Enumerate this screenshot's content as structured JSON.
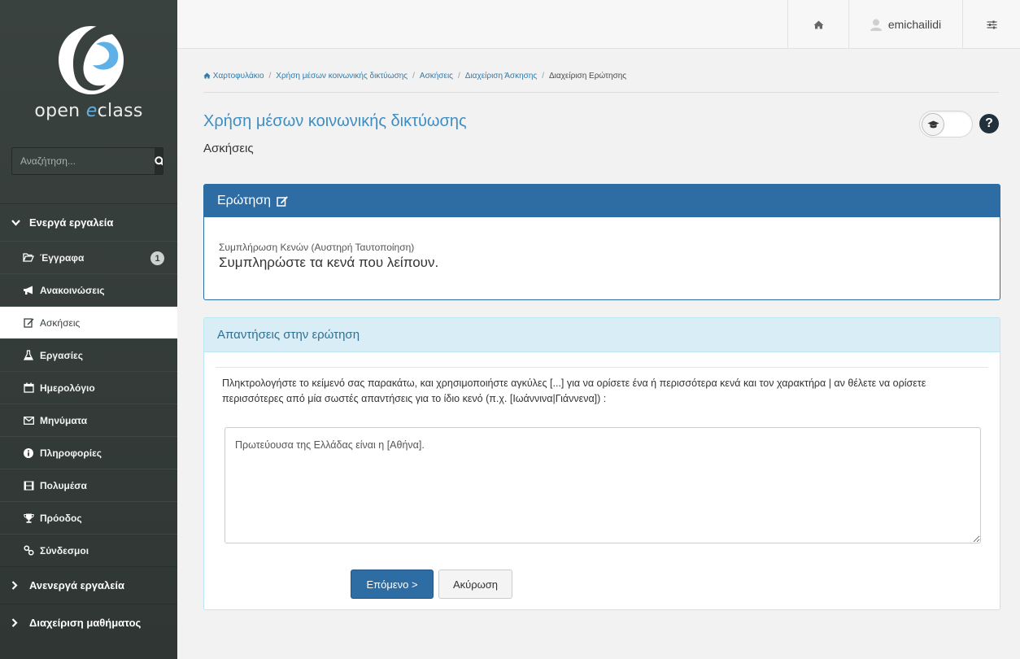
{
  "sidebar": {
    "logo_text_1": "open ",
    "logo_text_e": "e",
    "logo_text_2": "class",
    "search": {
      "placeholder": "Αναζήτηση..."
    },
    "active_tools_label": "Ενεργά εργαλεία",
    "items": [
      {
        "label": "Έγγραφα",
        "icon": "folder-open-icon",
        "badge": "1"
      },
      {
        "label": "Ανακοινώσεις",
        "icon": "bullhorn-icon"
      },
      {
        "label": "Ασκήσεις",
        "icon": "edit-icon",
        "active": true
      },
      {
        "label": "Εργασίες",
        "icon": "flask-icon"
      },
      {
        "label": "Ημερολόγιο",
        "icon": "calendar-icon"
      },
      {
        "label": "Μηνύματα",
        "icon": "envelope-icon"
      },
      {
        "label": "Πληροφορίες",
        "icon": "info-icon"
      },
      {
        "label": "Πολυμέσα",
        "icon": "film-icon"
      },
      {
        "label": "Πρόοδος",
        "icon": "trophy-icon"
      },
      {
        "label": "Σύνδεσμοι",
        "icon": "link-icon"
      }
    ],
    "inactive_tools_label": "Ανενεργά εργαλεία",
    "course_admin_label": "Διαχείριση μαθήματος"
  },
  "topbar": {
    "username": "emichailidi"
  },
  "breadcrumb": [
    "Χαρτοφυλάκιο",
    "Χρήση μέσων κοινωνικής δικτύωσης",
    "Ασκήσεις",
    "Διαχείριση Άσκησης",
    "Διαχείριση Ερώτησης"
  ],
  "course": {
    "title": "Χρήση μέσων κοινωνικής δικτύωσης",
    "subtitle": "Ασκήσεις"
  },
  "question_panel": {
    "title": "Ερώτηση",
    "type": "Συμπλήρωση Κενών (Αυστηρή Ταυτοποίηση)",
    "text": "Συμπληρώστε τα κενά που λείπουν."
  },
  "answers_panel": {
    "title": "Απαντήσεις στην ερώτηση",
    "instructions": "Πληκτρολογήστε το κείμενό σας παρακάτω, και χρησιμοποιήστε αγκύλες [...] για να ορίσετε ένα ή περισσότερα κενά και τον χαρακτήρα | αν θέλετε να ορίσετε περισσότερες από μία σωστές απαντήσεις για το ίδιο κενό (π.χ. [Ιωάννινα|Γιάννενα]) :",
    "answer_value": "Πρωτεύουσα της Ελλάδας είναι η [Αθήνα].",
    "next_label": "Επόμενο >",
    "cancel_label": "Ακύρωση"
  },
  "colors": {
    "primary": "#2e6da4",
    "sidebar": "#353d3b",
    "title_blue": "#3d8ec2",
    "info_bg": "#d9edf7"
  }
}
